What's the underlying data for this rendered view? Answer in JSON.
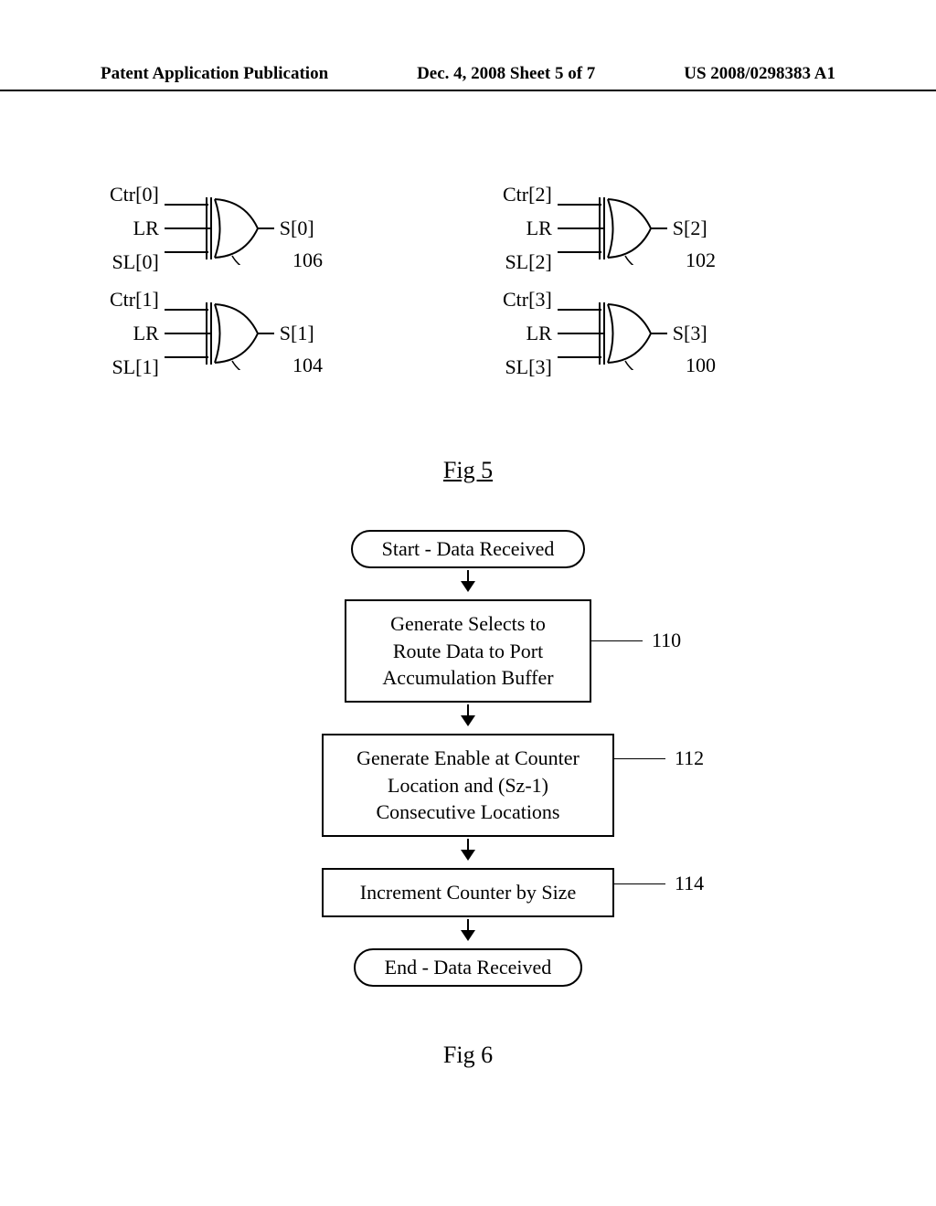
{
  "header": {
    "left": "Patent Application Publication",
    "center": "Dec. 4, 2008  Sheet 5 of 7",
    "right": "US 2008/0298383 A1"
  },
  "fig5": {
    "caption": "Fig 5",
    "gates": [
      {
        "in1": "Ctr[0]",
        "in2": "LR",
        "in3": "SL[0]",
        "out": "S[0]",
        "ref": "106"
      },
      {
        "in1": "Ctr[1]",
        "in2": "LR",
        "in3": "SL[1]",
        "out": "S[1]",
        "ref": "104"
      },
      {
        "in1": "Ctr[2]",
        "in2": "LR",
        "in3": "SL[2]",
        "out": "S[2]",
        "ref": "102"
      },
      {
        "in1": "Ctr[3]",
        "in2": "LR",
        "in3": "SL[3]",
        "out": "S[3]",
        "ref": "100"
      }
    ]
  },
  "fig6": {
    "caption": "Fig 6",
    "start": "Start - Data Received",
    "step1": {
      "l1": "Generate Selects to",
      "l2": "Route Data to Port",
      "l3": "Accumulation Buffer",
      "ref": "110"
    },
    "step2": {
      "l1": "Generate Enable at Counter",
      "l2": "Location and (Sz-1)",
      "l3": "Consecutive Locations",
      "ref": "112"
    },
    "step3": {
      "l1": "Increment Counter by Size",
      "ref": "114"
    },
    "end": "End - Data Received"
  }
}
